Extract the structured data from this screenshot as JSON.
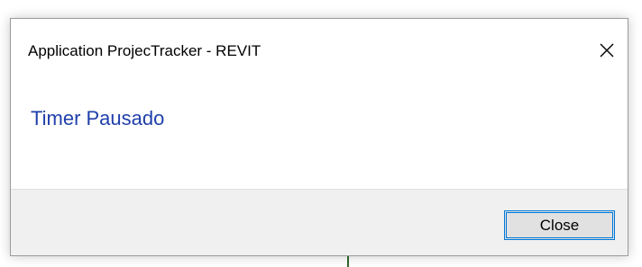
{
  "dialog": {
    "title": "Application ProjecTracker - REVIT",
    "message": "Timer Pausado",
    "close_button_label": "Close",
    "close_icon": "close-icon"
  },
  "colors": {
    "message_text": "#1f3faa",
    "footer_bg": "#f0f0f0",
    "button_bg": "#e1e1e1",
    "button_focus_border": "#0078d7"
  }
}
